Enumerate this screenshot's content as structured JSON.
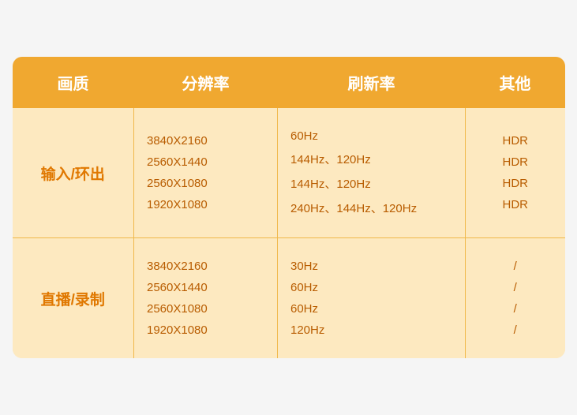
{
  "table": {
    "headers": [
      "画质",
      "分辨率",
      "刷新率",
      "其他"
    ],
    "rows": [
      {
        "label": "输入/环出",
        "entries": [
          {
            "resolution": "3840X2160",
            "refresh": "60Hz",
            "other": "HDR"
          },
          {
            "resolution": "2560X1440",
            "refresh": "144Hz、120Hz",
            "other": "HDR"
          },
          {
            "resolution": "2560X1080",
            "refresh": "144Hz、120Hz",
            "other": "HDR"
          },
          {
            "resolution": "1920X1080",
            "refresh": "240Hz、144Hz、120Hz",
            "other": "HDR"
          }
        ]
      },
      {
        "label": "直播/录制",
        "entries": [
          {
            "resolution": "3840X2160",
            "refresh": "30Hz",
            "other": "/"
          },
          {
            "resolution": "2560X1440",
            "refresh": "60Hz",
            "other": "/"
          },
          {
            "resolution": "2560X1080",
            "refresh": "60Hz",
            "other": "/"
          },
          {
            "resolution": "1920X1080",
            "refresh": "120Hz",
            "other": "/"
          }
        ]
      }
    ]
  },
  "colors": {
    "header_bg": "#f0a830",
    "card_bg": "#fde9c0",
    "label_color": "#e07800",
    "text_color": "#b85c00",
    "header_text": "#ffffff"
  }
}
